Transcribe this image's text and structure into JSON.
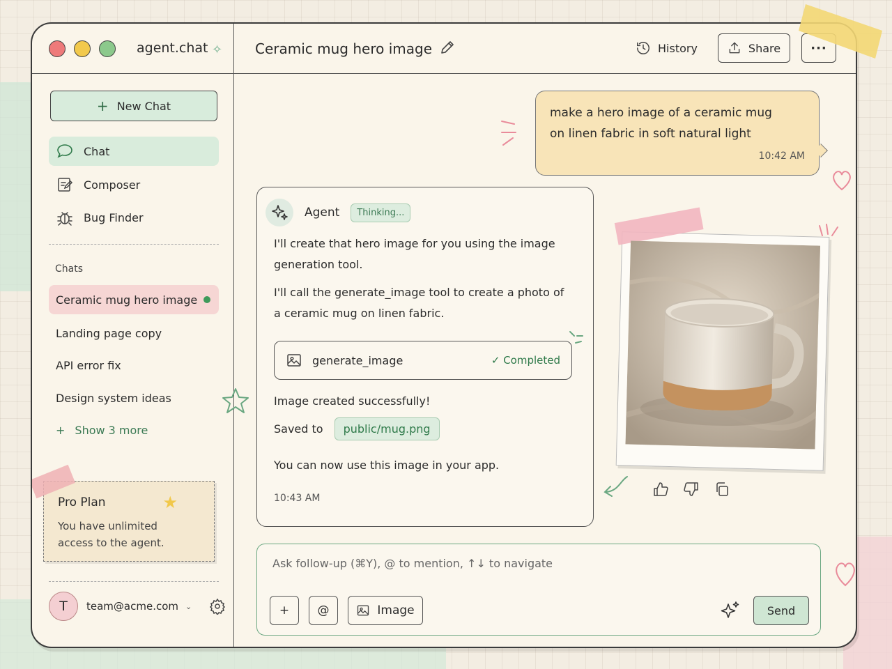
{
  "window": {
    "app_name": "agent.chat",
    "chat_title": "Ceramic mug hero image"
  },
  "header": {
    "history_label": "History",
    "share_label": "Share",
    "more_label": "···"
  },
  "sidebar": {
    "new_chat_label": "New Chat",
    "nav": [
      {
        "label": "Chat",
        "icon": "chat-bubble-icon",
        "active": true
      },
      {
        "label": "Composer",
        "icon": "compose-icon",
        "active": false
      },
      {
        "label": "Bug Finder",
        "icon": "bug-icon",
        "active": false
      }
    ],
    "chats_heading": "Chats",
    "chats": [
      {
        "label": "Ceramic mug hero image",
        "active": true
      },
      {
        "label": "Landing page copy",
        "active": false
      },
      {
        "label": "API error fix",
        "active": false
      },
      {
        "label": "Design system ideas",
        "active": false
      }
    ],
    "show_more_label": "Show 3 more",
    "plan": {
      "title": "Pro Plan",
      "description": "You have unlimited access to the agent."
    },
    "user": {
      "initial": "T",
      "email": "team@acme.com"
    }
  },
  "conversation": {
    "user_message": {
      "text_line1": "make a hero image of a ceramic mug",
      "text_line2": "on linen fabric in soft natural light",
      "time": "10:42 AM"
    },
    "agent_message": {
      "name": "Agent",
      "status": "Thinking...",
      "para1": "I'll create that hero image for you using the image generation tool.",
      "para2": "I'll call the generate_image tool to create a photo of a ceramic mug on linen fabric.",
      "tool_name": "generate_image",
      "tool_status": "Completed",
      "result_text": "Image created successfully!",
      "saved_label": "Saved to",
      "saved_path": "public/mug.png",
      "followup_text": "You can now use this image in your app.",
      "time": "10:43 AM"
    }
  },
  "composer": {
    "placeholder": "Ask follow-up (⌘Y), @ to mention, ↑↓ to navigate",
    "plus_label": "+",
    "mention_label": "@",
    "image_label": "Image",
    "send_label": "Send"
  },
  "colors": {
    "accent_green": "#3e9a5a",
    "mint": "#d9ecdc",
    "pink": "#f6d6d4",
    "yellow": "#f8e4b8"
  }
}
